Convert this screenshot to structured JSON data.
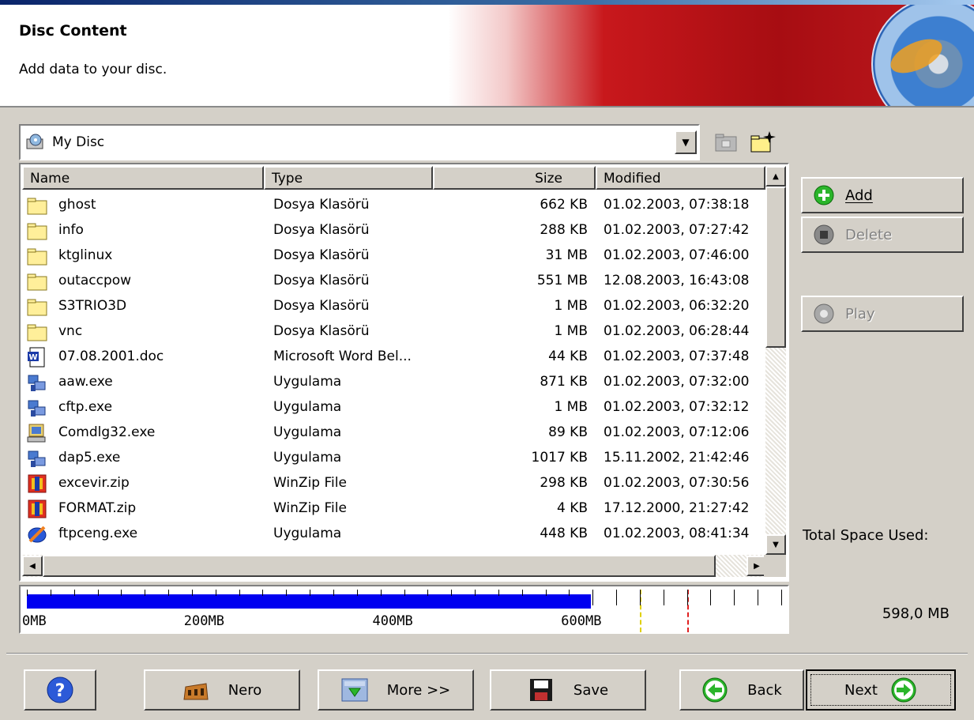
{
  "header": {
    "title": "Disc Content",
    "subtitle": "Add data to your disc."
  },
  "location": {
    "selected": "My Disc",
    "icon": "cd-drive-icon"
  },
  "columns": [
    "Name",
    "Type",
    "Size",
    "Modified"
  ],
  "files": [
    {
      "name": "ghost",
      "type": "Dosya Klasörü",
      "size": "662 KB",
      "modified": "01.02.2003, 07:38:18",
      "icon": "folder-icon"
    },
    {
      "name": "info",
      "type": "Dosya Klasörü",
      "size": "288 KB",
      "modified": "01.02.2003, 07:27:42",
      "icon": "folder-icon"
    },
    {
      "name": "ktglinux",
      "type": "Dosya Klasörü",
      "size": "31 MB",
      "modified": "01.02.2003, 07:46:00",
      "icon": "folder-icon"
    },
    {
      "name": "outaccpow",
      "type": "Dosya Klasörü",
      "size": "551 MB",
      "modified": "12.08.2003, 16:43:08",
      "icon": "folder-icon"
    },
    {
      "name": "S3TRIO3D",
      "type": "Dosya Klasörü",
      "size": "1 MB",
      "modified": "01.02.2003, 06:32:20",
      "icon": "folder-icon"
    },
    {
      "name": "vnc",
      "type": "Dosya Klasörü",
      "size": "1 MB",
      "modified": "01.02.2003, 06:28:44",
      "icon": "folder-icon"
    },
    {
      "name": "07.08.2001.doc",
      "type": "Microsoft Word Bel...",
      "size": "44 KB",
      "modified": "01.02.2003, 07:37:48",
      "icon": "word-document-icon"
    },
    {
      "name": "aaw.exe",
      "type": "Uygulama",
      "size": "871 KB",
      "modified": "01.02.2003, 07:32:00",
      "icon": "application-icon"
    },
    {
      "name": "cftp.exe",
      "type": "Uygulama",
      "size": "1 MB",
      "modified": "01.02.2003, 07:32:12",
      "icon": "application-icon"
    },
    {
      "name": "Comdlg32.exe",
      "type": "Uygulama",
      "size": "89 KB",
      "modified": "01.02.2003, 07:12:06",
      "icon": "installer-icon"
    },
    {
      "name": "dap5.exe",
      "type": "Uygulama",
      "size": "1017 KB",
      "modified": "15.11.2002, 21:42:46",
      "icon": "application-icon"
    },
    {
      "name": "excevir.zip",
      "type": "WinZip File",
      "size": "298 KB",
      "modified": "01.02.2003, 07:30:56",
      "icon": "winzip-icon"
    },
    {
      "name": "FORMAT.zip",
      "type": "WinZip File",
      "size": "4 KB",
      "modified": "17.12.2000, 21:27:42",
      "icon": "winzip-icon"
    },
    {
      "name": "ftpceng.exe",
      "type": "Uygulama",
      "size": "448 KB",
      "modified": "01.02.2003, 08:41:34",
      "icon": "ftp-app-icon"
    }
  ],
  "side_buttons": {
    "add": "Add",
    "delete": "Delete",
    "play": "Play"
  },
  "space": {
    "label": "Total Space Used:",
    "value": "598,0 MB",
    "used_mb": 598,
    "scale_max_mb": 800,
    "marker_yellow_mb": 650,
    "marker_red_mb": 700,
    "scale_labels": [
      "0MB",
      "200MB",
      "400MB",
      "600MB"
    ]
  },
  "bottom_buttons": {
    "nero": "Nero",
    "more": "More >>",
    "save": "Save",
    "back": "Back",
    "next": "Next"
  },
  "colors": {
    "meter_fill": "#0000f0",
    "marker_yellow": "#e0d000",
    "marker_red": "#e02020"
  }
}
